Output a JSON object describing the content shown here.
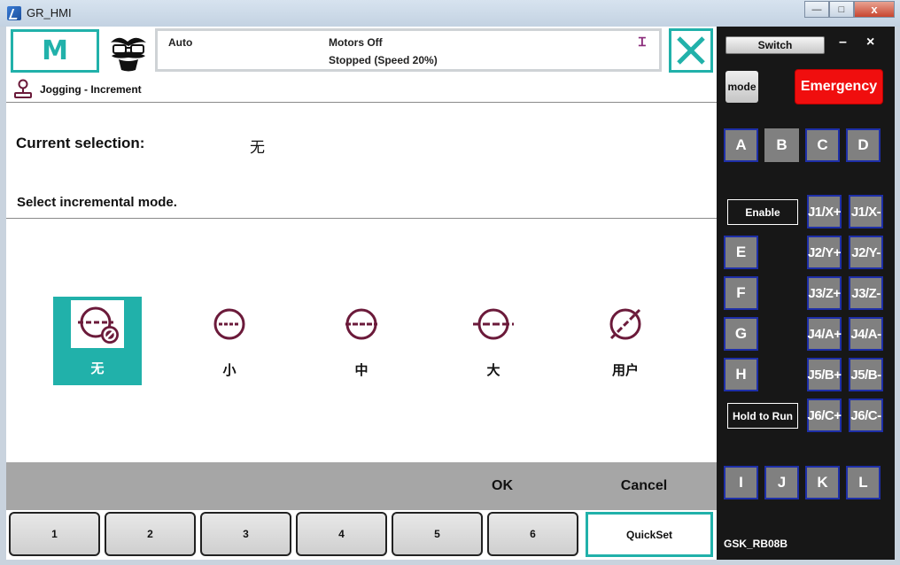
{
  "window": {
    "title": "GR_HMI",
    "minimize": "—",
    "maximize": "□",
    "close": "x"
  },
  "header": {
    "mode_letter": "M",
    "status_mode": "Auto",
    "motors": "Motors Off",
    "stopped": "Stopped (Speed 20%)",
    "tool_glyph": "Ɪ"
  },
  "subheader": {
    "title": "Jogging - Increment"
  },
  "selection": {
    "label": "Current selection:",
    "value": "无",
    "instruction": "Select incremental mode."
  },
  "options": [
    {
      "label": "无",
      "icon": "increment-none-icon",
      "selected": true
    },
    {
      "label": "小",
      "icon": "increment-small-icon",
      "selected": false
    },
    {
      "label": "中",
      "icon": "increment-medium-icon",
      "selected": false
    },
    {
      "label": "大",
      "icon": "increment-large-icon",
      "selected": false
    },
    {
      "label": "用户",
      "icon": "increment-user-icon",
      "selected": false
    }
  ],
  "actions": {
    "ok": "OK",
    "cancel": "Cancel"
  },
  "tabs": [
    "1",
    "2",
    "3",
    "4",
    "5",
    "6"
  ],
  "quickset": "QuickSet",
  "side": {
    "switch": "Switch",
    "minimize": "–",
    "close": "×",
    "mode": "mode",
    "emergency": "Emergency",
    "top_buttons": [
      "A",
      "B",
      "C",
      "D"
    ],
    "enable": "Enable",
    "hold_to_run": "Hold to Run",
    "left_buttons": [
      "E",
      "F",
      "G",
      "H"
    ],
    "jog_plus": [
      "J1/X+",
      "J2/Y+",
      "J3/Z+",
      "J4/A+",
      "J5/B+",
      "J6/C+"
    ],
    "jog_minus": [
      "J1/X-",
      "J2/Y-",
      "J3/Z-",
      "J4/A-",
      "J5/B-",
      "J6/C-"
    ],
    "bottom_buttons": [
      "I",
      "J",
      "K",
      "L"
    ],
    "model": "GSK_RB08B"
  },
  "colors": {
    "accent": "#21b1aa",
    "emergency": "#f00e0e",
    "icon": "#6b1a3a",
    "panel": "#171717",
    "key_border": "#1e2fa8"
  }
}
